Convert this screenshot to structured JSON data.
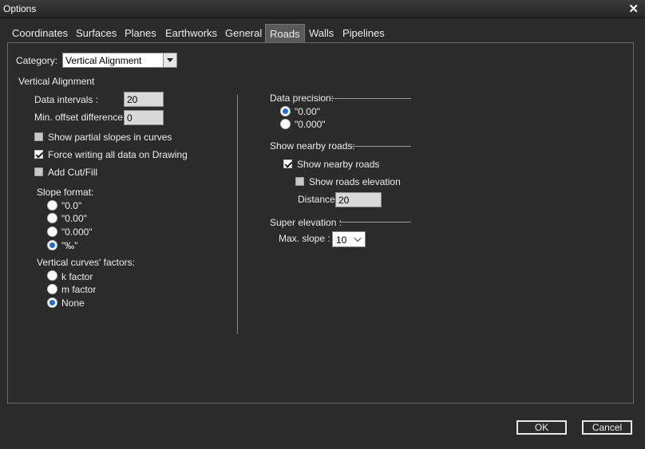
{
  "window": {
    "title": "Options"
  },
  "tabs": [
    {
      "label": "Coordinates"
    },
    {
      "label": "Surfaces"
    },
    {
      "label": "Planes"
    },
    {
      "label": "Earthworks"
    },
    {
      "label": "General"
    },
    {
      "label": "Roads",
      "active": true
    },
    {
      "label": "Walls"
    },
    {
      "label": "Pipelines"
    }
  ],
  "category": {
    "label": "Category:",
    "value": "Vertical Alignment"
  },
  "left": {
    "section_title": "Vertical Alignment",
    "data_intervals": {
      "label": "Data intervals :",
      "value": "20"
    },
    "min_offset": {
      "label": "Min. offset  difference:",
      "value": "0"
    },
    "checkboxes": [
      {
        "label": "Show partial slopes in curves",
        "checked": false
      },
      {
        "label": "Force writing all data on Drawing",
        "checked": true
      },
      {
        "label": "Add Cut/Fill",
        "checked": false
      }
    ],
    "slope_format": {
      "label": "Slope format:",
      "options": [
        "\"0.0\"",
        "\"0.00\"",
        "\"0.000\"",
        "\"‰\""
      ],
      "selected": 3
    },
    "vertical_curves": {
      "label": "Vertical curves' factors:",
      "options": [
        "k factor",
        "m factor",
        "None"
      ],
      "selected": 2
    }
  },
  "right": {
    "data_precision": {
      "label": "Data precision:",
      "options": [
        "\"0.00\"",
        "\"0.000\""
      ],
      "selected": 0
    },
    "nearby_roads": {
      "label": "Show nearby roads:",
      "show_nearby": {
        "label": "Show nearby roads",
        "checked": true
      },
      "show_elevation": {
        "label": "Show roads elevation",
        "checked": false
      },
      "distance": {
        "label": "Distance:",
        "value": "20"
      }
    },
    "super_elevation": {
      "label": "Super elevation :",
      "max_slope": {
        "label": "Max. slope :",
        "value": "10"
      }
    }
  },
  "buttons": {
    "ok": "OK",
    "cancel": "Cancel"
  },
  "colors": {
    "background": "#2b2b2b",
    "radio_selected": "#1f6fd1",
    "text": "#ececec"
  }
}
